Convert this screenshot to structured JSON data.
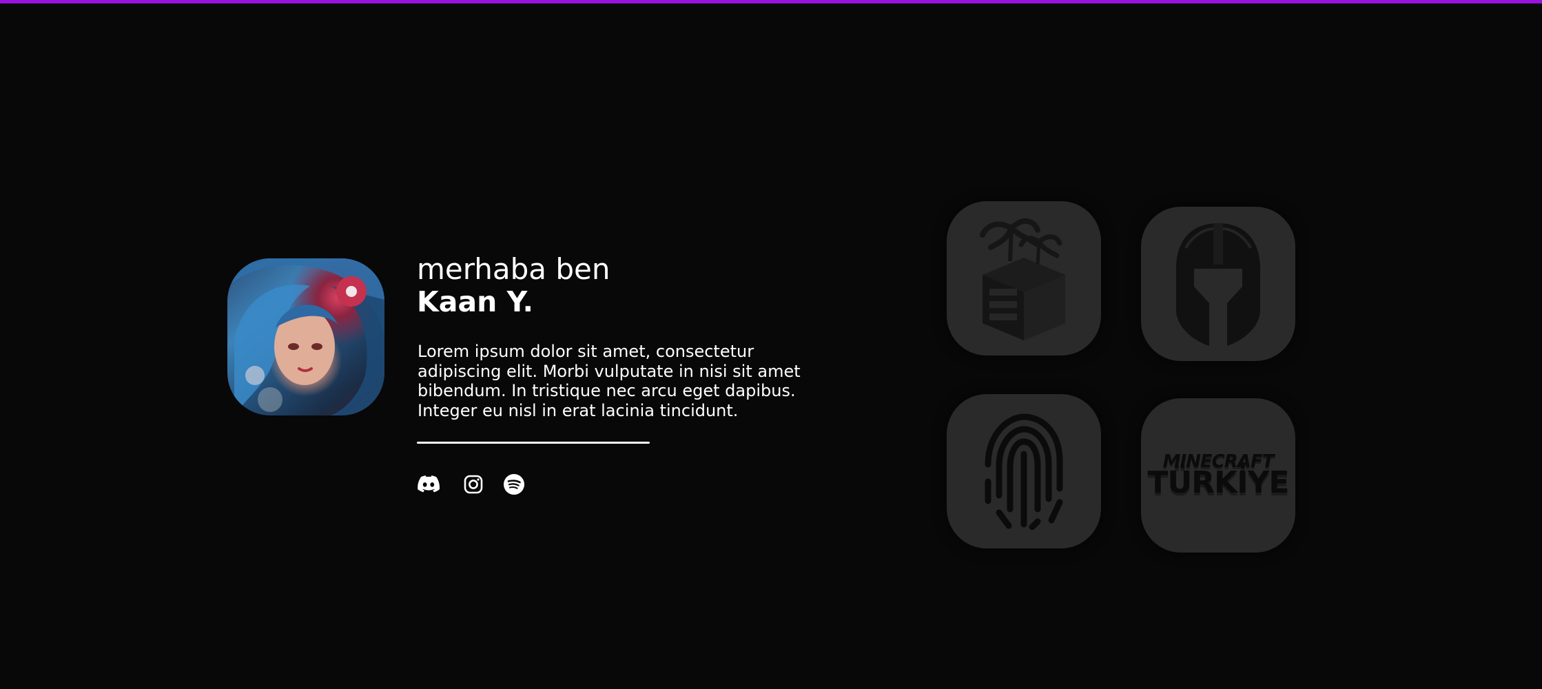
{
  "accent": {
    "top_bar": "#9b12de"
  },
  "profile": {
    "greeting": "merhaba ben",
    "name": "Kaan Y.",
    "bio": "Lorem ipsum dolor sit amet, consectetur adipiscing elit. Morbi vulputate in nisi sit amet bibendum. In tristique nec arcu eget dapibus. Integer eu nisl in erat lacinia tincidunt.",
    "avatar_icon": "anime-avatar"
  },
  "socials": [
    {
      "name": "Discord",
      "icon": "discord-icon"
    },
    {
      "name": "Instagram",
      "icon": "instagram-icon"
    },
    {
      "name": "Spotify",
      "icon": "spotify-icon"
    }
  ],
  "projects": [
    {
      "icon": "island-server-icon",
      "logo_text": ""
    },
    {
      "icon": "spartan-helmet-icon",
      "logo_text": ""
    },
    {
      "icon": "fingerprint-icon",
      "logo_text": ""
    },
    {
      "icon": "minecraft-turkiye-logo",
      "logo_text": "MINECRAFT TÜRKİYE"
    }
  ]
}
